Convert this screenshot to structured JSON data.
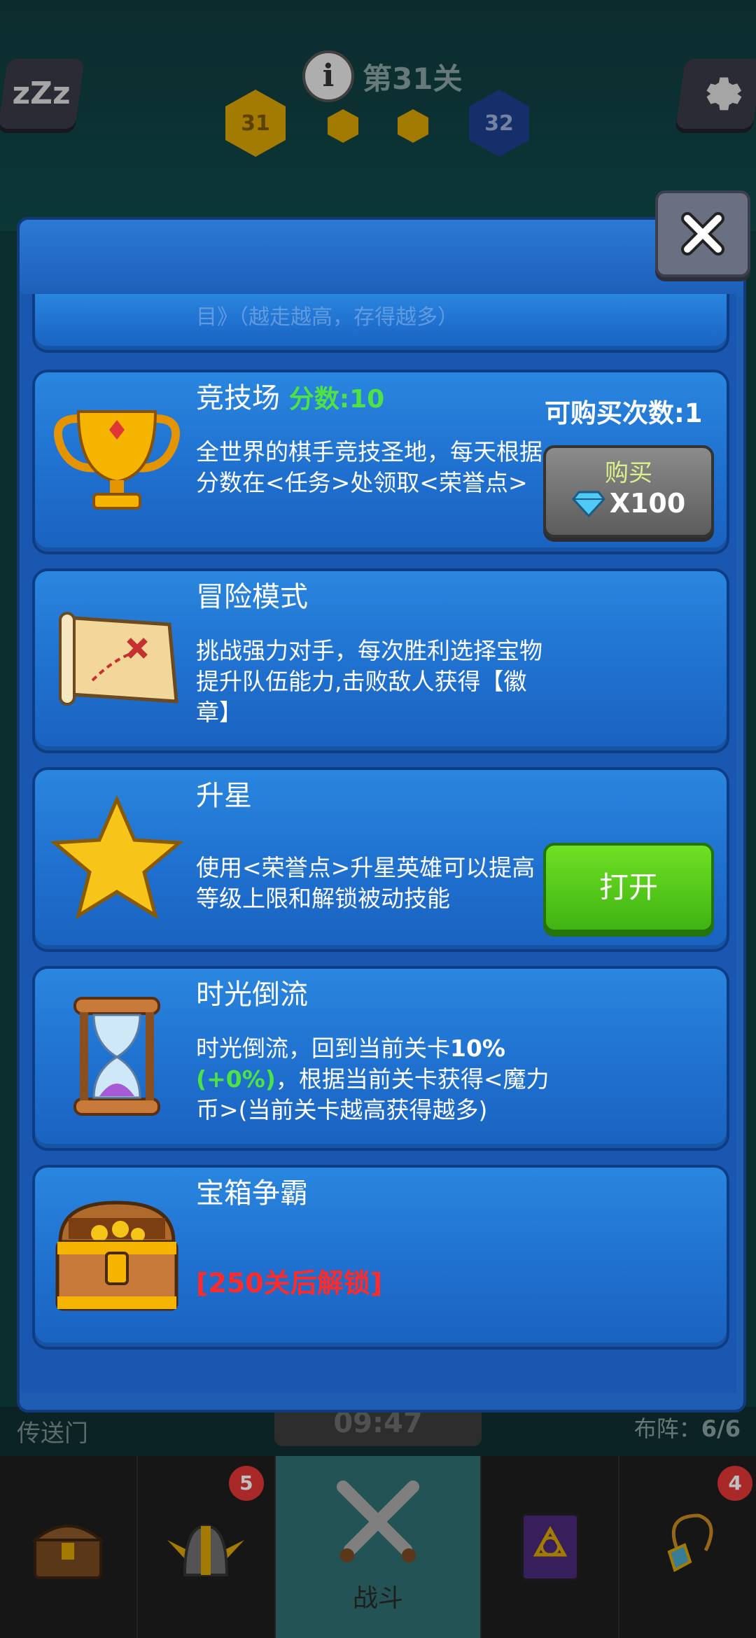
{
  "top_bar": {
    "level_title": "第31关",
    "current_level": "31",
    "next_level": "32"
  },
  "bottom_area": {
    "portal_label": "传送门",
    "timer": "09:47",
    "formation_label": "布阵：",
    "formation_value": "6/6"
  },
  "navbar": {
    "items": [
      {
        "name": "chest",
        "badge": ""
      },
      {
        "name": "heroes",
        "badge": "5"
      },
      {
        "name": "battle",
        "label": "战斗"
      },
      {
        "name": "book",
        "badge": ""
      },
      {
        "name": "amulet",
        "badge": "4"
      }
    ]
  },
  "modal": {
    "partial_card_text": "目》（越走越高，存得越多）",
    "cards": [
      {
        "title": "竞技场",
        "score_label": "分数:10",
        "desc": "全世界的棋手竞技圣地，每天根据分数在<任务>处领取<荣誉点>",
        "purchase_count": "可购买次数:1",
        "button_label": "购买",
        "price": "X100",
        "icon": "trophy-icon"
      },
      {
        "title": "冒险模式",
        "desc": "挑战强力对手，每次胜利选择宝物提升队伍能力,击败敌人获得【徽章】",
        "icon": "map-icon"
      },
      {
        "title": "升星",
        "desc": "使用<荣誉点>升星英雄可以提高等级上限和解锁被动技能",
        "button_label": "打开",
        "icon": "star-icon"
      },
      {
        "title": "时光倒流",
        "desc_a": "时光倒流，回到当前关卡",
        "desc_pct": "10%",
        "desc_green": "(+0%)",
        "desc_b": "，根据当前关卡获得<魔力币>(当前关卡越高获得越多)",
        "icon": "hourglass-icon"
      },
      {
        "title": "宝箱争霸",
        "locked_text": "[250关后解锁]",
        "icon": "treasure-chest-icon"
      }
    ]
  },
  "colors": {
    "card_blue": "#1f70cf",
    "green_button": "#4fc81a",
    "score_green": "#4ee244",
    "locked_red": "#ff2a2a"
  }
}
